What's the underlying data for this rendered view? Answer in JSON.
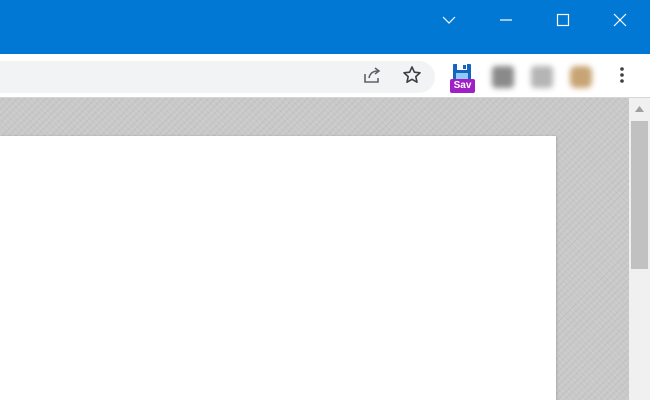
{
  "window": {
    "tab_search_icon": "chevron-down-icon",
    "minimize_icon": "minimize-icon",
    "maximize_icon": "maximize-icon",
    "close_icon": "close-icon",
    "accent_color": "#0078d4"
  },
  "toolbar": {
    "share_icon": "share-icon",
    "bookmark_icon": "star-icon",
    "extension_badge": "Sav",
    "menu_icon": "more-vertical-icon"
  },
  "colors": {
    "titlebar": "#0078d4",
    "extension_badge": "#a020c8",
    "page_background": "#c9c9c9",
    "page": "#ffffff"
  }
}
